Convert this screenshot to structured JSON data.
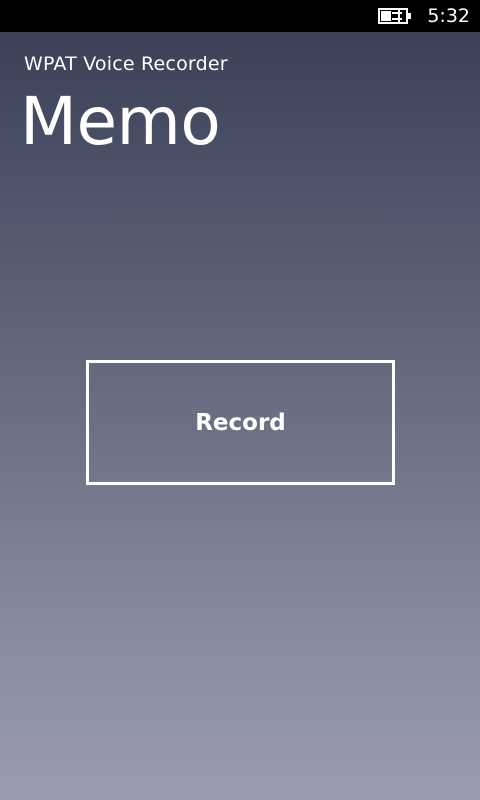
{
  "status_bar": {
    "time": "5:32",
    "battery_icon": "battery-charging-icon"
  },
  "app": {
    "title": "WPAT Voice Recorder",
    "page_title": "Memo"
  },
  "main": {
    "record_label": "Record"
  },
  "colors": {
    "background_top": "#353b50",
    "background_bottom": "#999cae",
    "foreground": "#ffffff",
    "status_bar": "#000000"
  }
}
